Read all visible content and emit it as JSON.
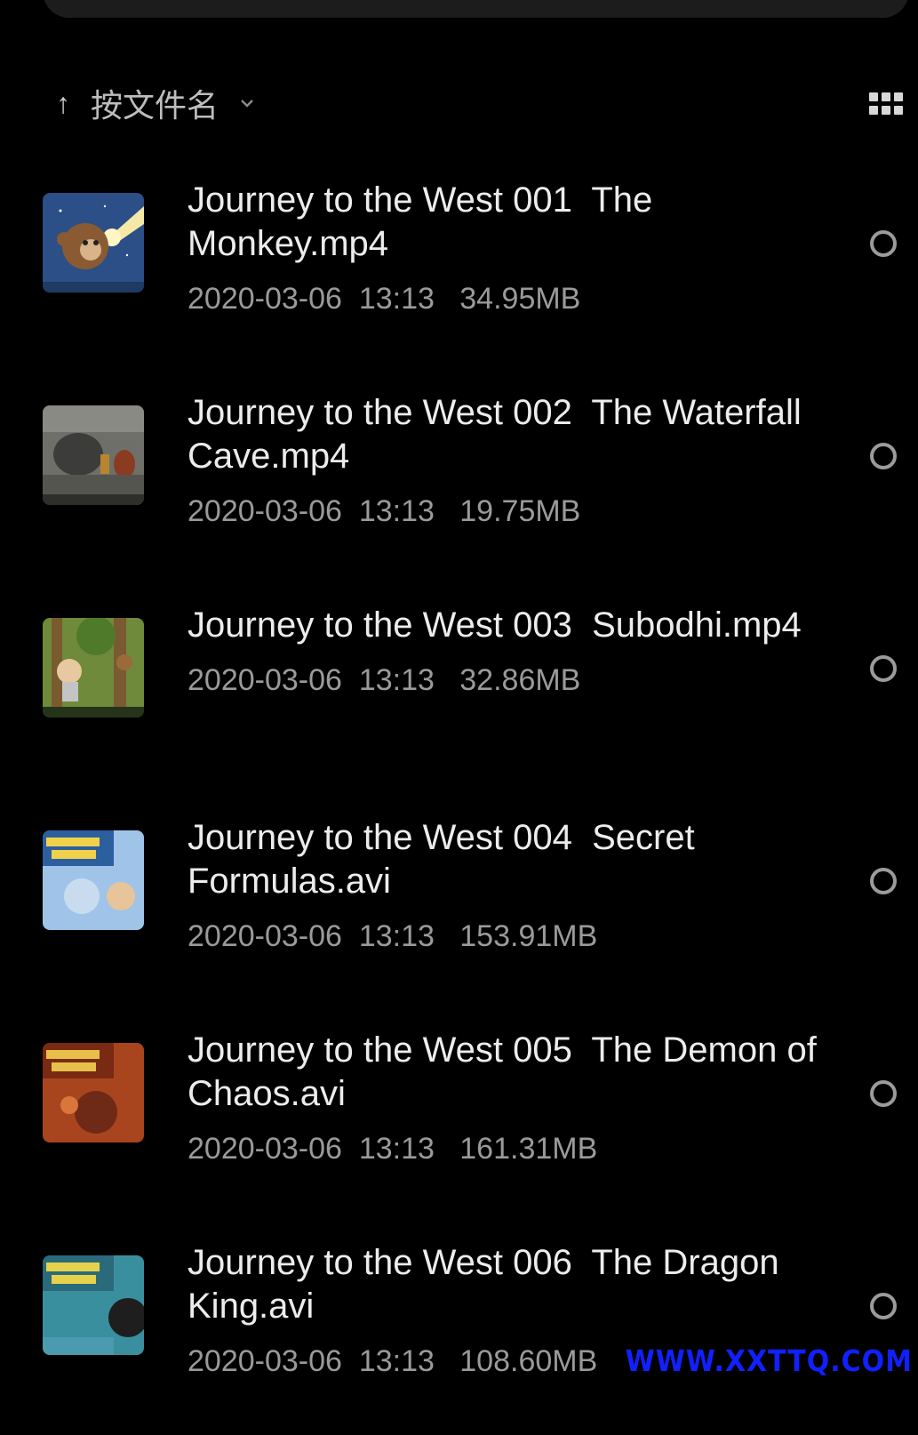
{
  "toolbar": {
    "sort_arrow": "↑",
    "sort_label": "按文件名",
    "view_toggle_icon": "grid-icon"
  },
  "files": [
    {
      "title": "Journey to the West 001  The Monkey.mp4",
      "date": "2020-03-06",
      "time": "13:13",
      "size": "34.95MB",
      "thumb": "monkey-thumbnail"
    },
    {
      "title": "Journey to the West 002  The Waterfall Cave.mp4",
      "date": "2020-03-06",
      "time": "13:13",
      "size": "19.75MB",
      "thumb": "cave-thumbnail"
    },
    {
      "title": "Journey to the West 003  Subodhi.mp4",
      "date": "2020-03-06",
      "time": "13:13",
      "size": "32.86MB",
      "thumb": "forest-thumbnail"
    },
    {
      "title": "Journey to the West 004  Secret Formulas.avi",
      "date": "2020-03-06",
      "time": "13:13",
      "size": "153.91MB",
      "thumb": "title-card-blue-thumbnail"
    },
    {
      "title": "Journey to the West 005  The Demon of Chaos.avi",
      "date": "2020-03-06",
      "time": "13:13",
      "size": "161.31MB",
      "thumb": "title-card-red-thumbnail"
    },
    {
      "title": "Journey to the West 006  The Dragon King.avi",
      "date": "2020-03-06",
      "time": "13:13",
      "size": "108.60MB",
      "thumb": "title-card-sea-thumbnail"
    }
  ],
  "watermark": "WWW.XXTTQ.COM",
  "colors": {
    "background": "#000000",
    "title": "#ececec",
    "meta": "#9a9a9a",
    "watermark": "#1020ff"
  }
}
